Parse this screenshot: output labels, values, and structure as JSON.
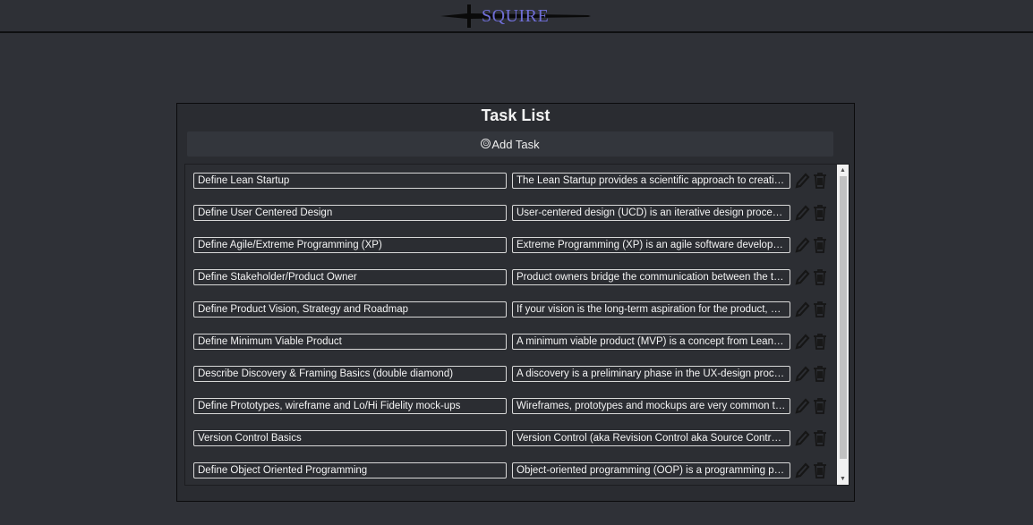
{
  "header": {
    "logo_text": "SQUIRE"
  },
  "panel": {
    "title": "Task List",
    "add_button_icon": "⊙",
    "add_button_label": "Add Task"
  },
  "tasks": [
    {
      "title": "Define Lean Startup",
      "description": "The Lean Startup provides a scientific approach to creating and managing startups"
    },
    {
      "title": "Define User Centered Design",
      "description": "User-centered design (UCD) is an iterative design process in which designers focus on the users"
    },
    {
      "title": "Define Agile/Extreme Programming (XP)",
      "description": "Extreme Programming (XP) is an agile software development framework"
    },
    {
      "title": "Define Stakeholder/Product Owner",
      "description": "Product owners bridge the communication between the team and stakeholders"
    },
    {
      "title": "Define Product Vision, Strategy and Roadmap",
      "description": "If your vision is the long-term aspiration for the product, and the strategy is the plan"
    },
    {
      "title": "Define Minimum Viable Product",
      "description": "A minimum viable product (MVP) is a concept from Lean Startup"
    },
    {
      "title": "Describe Discovery & Framing Basics (double diamond)",
      "description": "A discovery is a preliminary phase in the UX-design process that involves research"
    },
    {
      "title": "Define Prototypes, wireframe and Lo/Hi Fidelity mock-ups",
      "description": "Wireframes, prototypes and mockups are very common terms in design"
    },
    {
      "title": "Version Control Basics",
      "description": "Version Control (aka Revision Control aka Source Control) lets you track changes"
    },
    {
      "title": "Define Object Oriented Programming",
      "description": "Object-oriented programming (OOP) is a programming paradigm based on objects"
    }
  ],
  "icons": {
    "edit": "pencil-icon",
    "delete": "trash-icon",
    "logo": "sword-icon"
  },
  "colors": {
    "logo_text": "#6f6ed6",
    "background": "#2f3137",
    "panel": "#2a2c31"
  }
}
